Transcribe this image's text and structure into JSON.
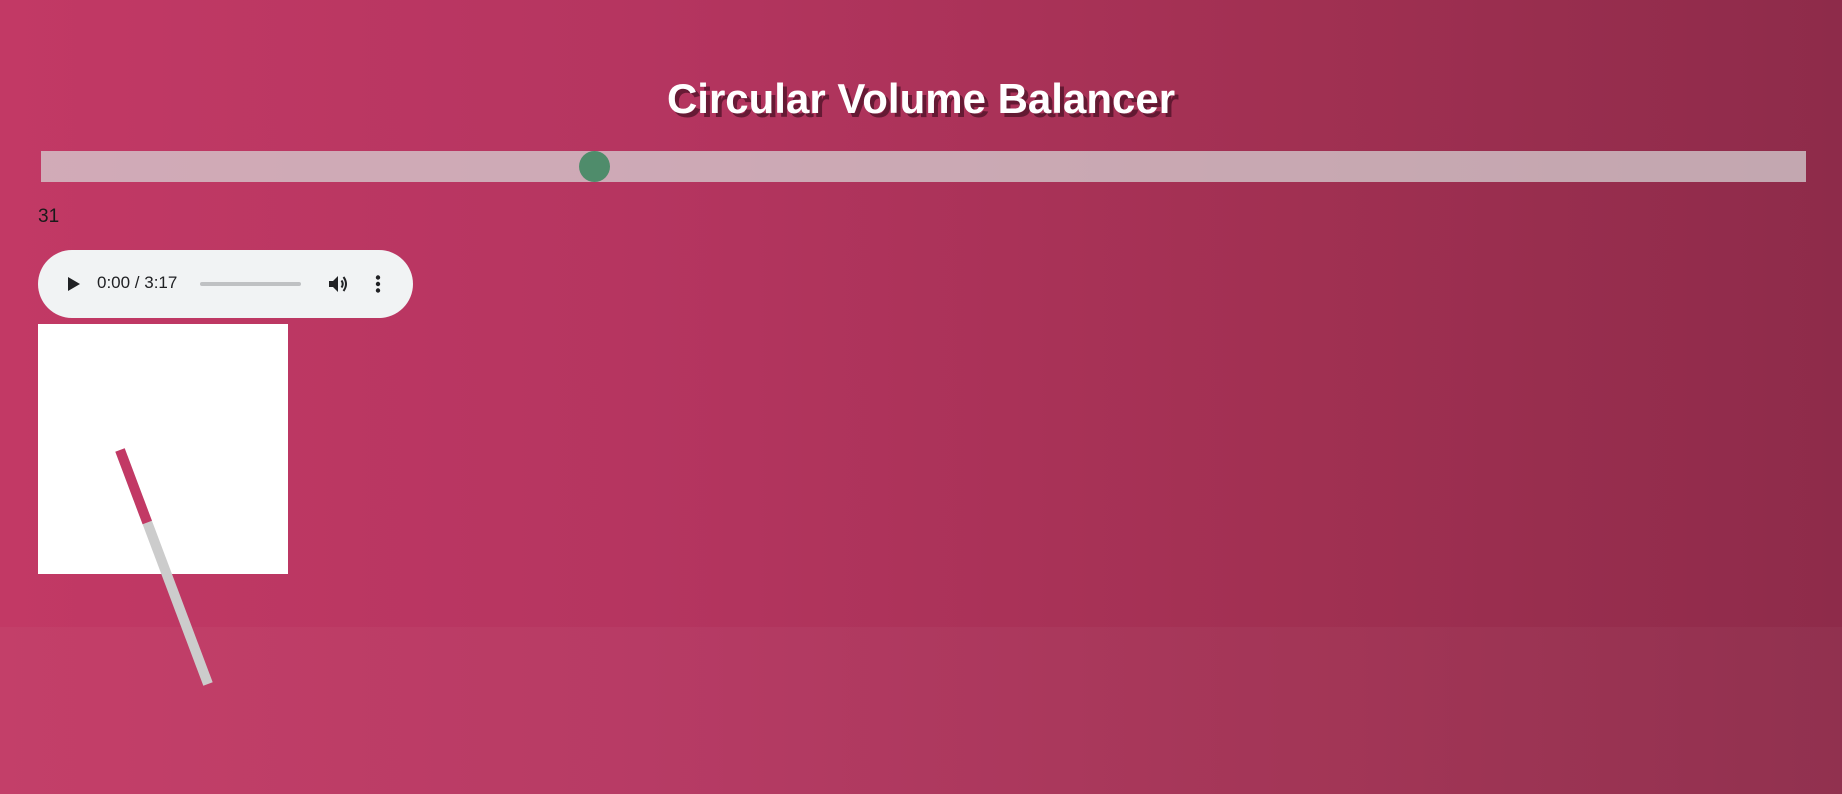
{
  "page": {
    "title": "Circular Volume Balancer"
  },
  "volume": {
    "value": 31,
    "display": "31",
    "max": 100
  },
  "audio": {
    "time_display": "0:00 / 3:17",
    "current_time": "0:00",
    "duration": "3:17",
    "progress": 0
  },
  "colors": {
    "background_start": "#c23965",
    "background_end": "#8e2b4a",
    "slider_thumb": "#4f8c6b",
    "knob_active": "#c23965",
    "knob_inactive": "#cccccc"
  },
  "icons": {
    "play": "play-icon",
    "volume": "volume-icon",
    "more": "more-vert-icon"
  }
}
